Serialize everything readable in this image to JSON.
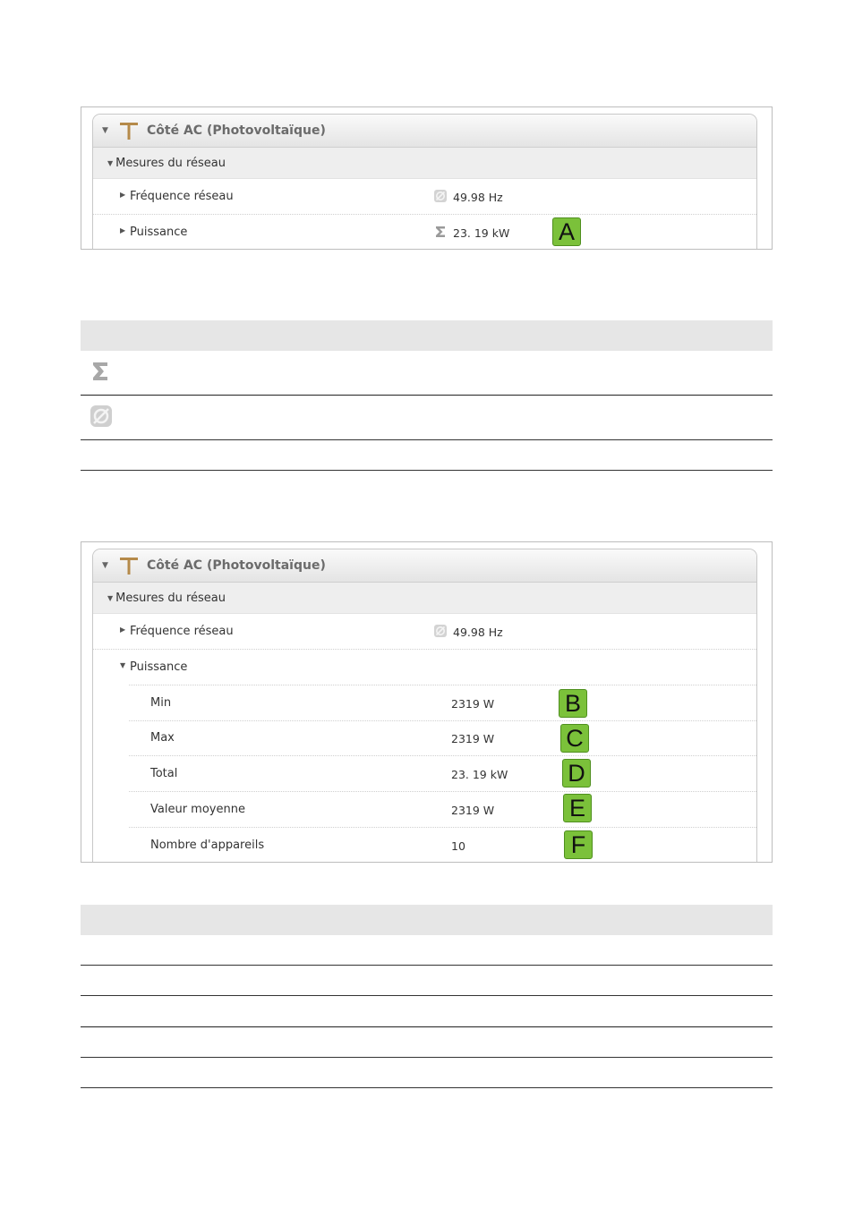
{
  "screenshot1": {
    "panel_title": "Côté AC  (Photovoltaïque)",
    "title_icon": "pv-ac-side-icon",
    "group_label": "Mesures du réseau",
    "rows": [
      {
        "label": "Fréquence réseau",
        "value": "49.98 Hz",
        "icon": "average-icon"
      },
      {
        "label": "Puissance",
        "value": "23. 19 kW",
        "icon": "sum-icon",
        "badge": "A"
      }
    ]
  },
  "legend_table1": {
    "rows": [
      {
        "icon": "sum-icon"
      },
      {
        "icon": "average-icon"
      }
    ]
  },
  "screenshot2": {
    "panel_title": "Côté AC  (Photovoltaïque)",
    "title_icon": "pv-ac-side-icon",
    "group_label": "Mesures du réseau",
    "frequency": {
      "label": "Fréquence réseau",
      "value": "49.98 Hz",
      "icon": "average-icon"
    },
    "power_label": "Puissance",
    "sub_rows": [
      {
        "label": "Min",
        "value": "2319 W",
        "badge": "B"
      },
      {
        "label": "Max",
        "value": "2319 W",
        "badge": "C"
      },
      {
        "label": "Total",
        "value": "23. 19 kW",
        "badge": "D"
      },
      {
        "label": "Valeur moyenne",
        "value": "2319 W",
        "badge": "E"
      },
      {
        "label": "Nombre d'appareils",
        "value": "10",
        "badge": "F"
      }
    ]
  },
  "colors": {
    "badge_green": "#7bc13a",
    "header_gray": "#e6e6e6",
    "icon_brown": "#b58a4a"
  }
}
